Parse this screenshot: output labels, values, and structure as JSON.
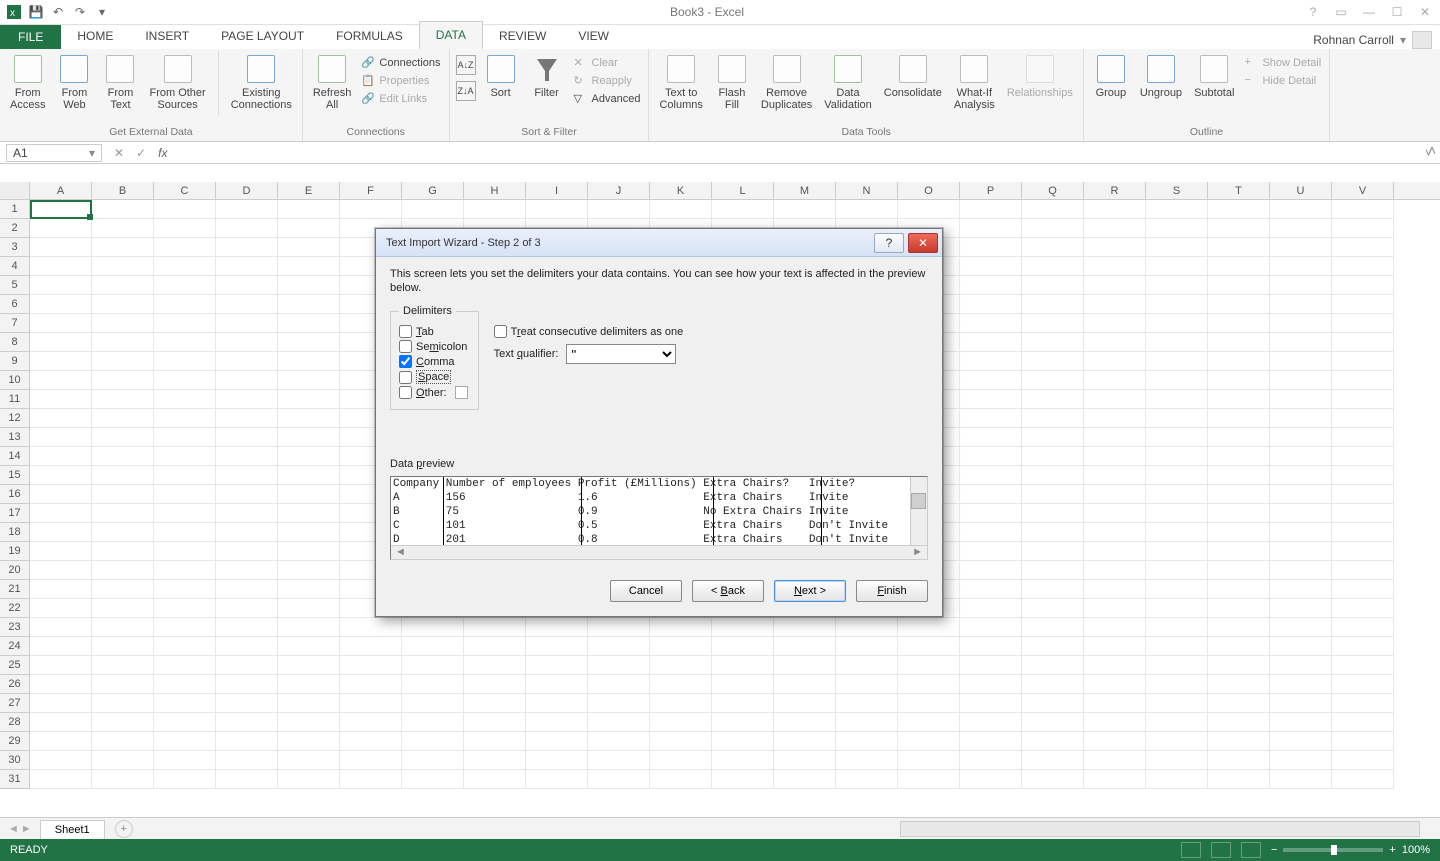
{
  "app": {
    "title": "Book3 - Excel",
    "user": "Rohnan Carroll"
  },
  "tabs": {
    "file": "FILE",
    "home": "HOME",
    "insert": "INSERT",
    "pagelayout": "PAGE LAYOUT",
    "formulas": "FORMULAS",
    "data": "DATA",
    "review": "REVIEW",
    "view": "VIEW"
  },
  "ribbon": {
    "ext": {
      "fromaccess": "From\nAccess",
      "fromweb": "From\nWeb",
      "fromtext": "From\nText",
      "fromother": "From Other\nSources",
      "existing": "Existing\nConnections",
      "label": "Get External Data"
    },
    "conn": {
      "refresh": "Refresh\nAll",
      "connections": "Connections",
      "properties": "Properties",
      "editlinks": "Edit Links",
      "label": "Connections"
    },
    "sort": {
      "sort": "Sort",
      "filter": "Filter",
      "clear": "Clear",
      "reapply": "Reapply",
      "advanced": "Advanced",
      "label": "Sort & Filter"
    },
    "tools": {
      "ttc": "Text to\nColumns",
      "flash": "Flash\nFill",
      "remdup": "Remove\nDuplicates",
      "valid": "Data\nValidation",
      "consol": "Consolidate",
      "whatif": "What-If\nAnalysis",
      "rel": "Relationships",
      "label": "Data Tools"
    },
    "outline": {
      "group": "Group",
      "ungroup": "Ungroup",
      "subtotal": "Subtotal",
      "showdet": "Show Detail",
      "hidedet": "Hide Detail",
      "label": "Outline"
    }
  },
  "namebox": "A1",
  "columns": [
    "A",
    "B",
    "C",
    "D",
    "E",
    "F",
    "G",
    "H",
    "I",
    "J",
    "K",
    "L",
    "M",
    "N",
    "O",
    "P",
    "Q",
    "R",
    "S",
    "T",
    "U",
    "V"
  ],
  "rowcount": 31,
  "sheet": "Sheet1",
  "status": {
    "ready": "READY",
    "zoom": "100%"
  },
  "dialog": {
    "title": "Text Import Wizard - Step 2 of 3",
    "desc": "This screen lets you set the delimiters your data contains.  You can see how your text is affected in the preview below.",
    "delim_legend": "Delimiters",
    "tab": "Tab",
    "semicolon": "Semicolon",
    "comma": "Comma",
    "space": "Space",
    "other": "Other:",
    "treat": "Treat consecutive delimiters as one",
    "qualifier_label": "Text qualifier:",
    "qualifier_value": "\"",
    "preview_label": "Data preview",
    "previewtext": "Company Number of employees Profit (£Millions) Extra Chairs?   Invite?\nA       156                 1.6                Extra Chairs    Invite\nB       75                  0.9                No Extra Chairs Invite\nC       101                 0.5                Extra Chairs    Don't Invite\nD       201                 0.8                Extra Chairs    Don't Invite",
    "buttons": {
      "cancel": "Cancel",
      "back": "< Back",
      "next": "Next >",
      "finish": "Finish"
    }
  }
}
